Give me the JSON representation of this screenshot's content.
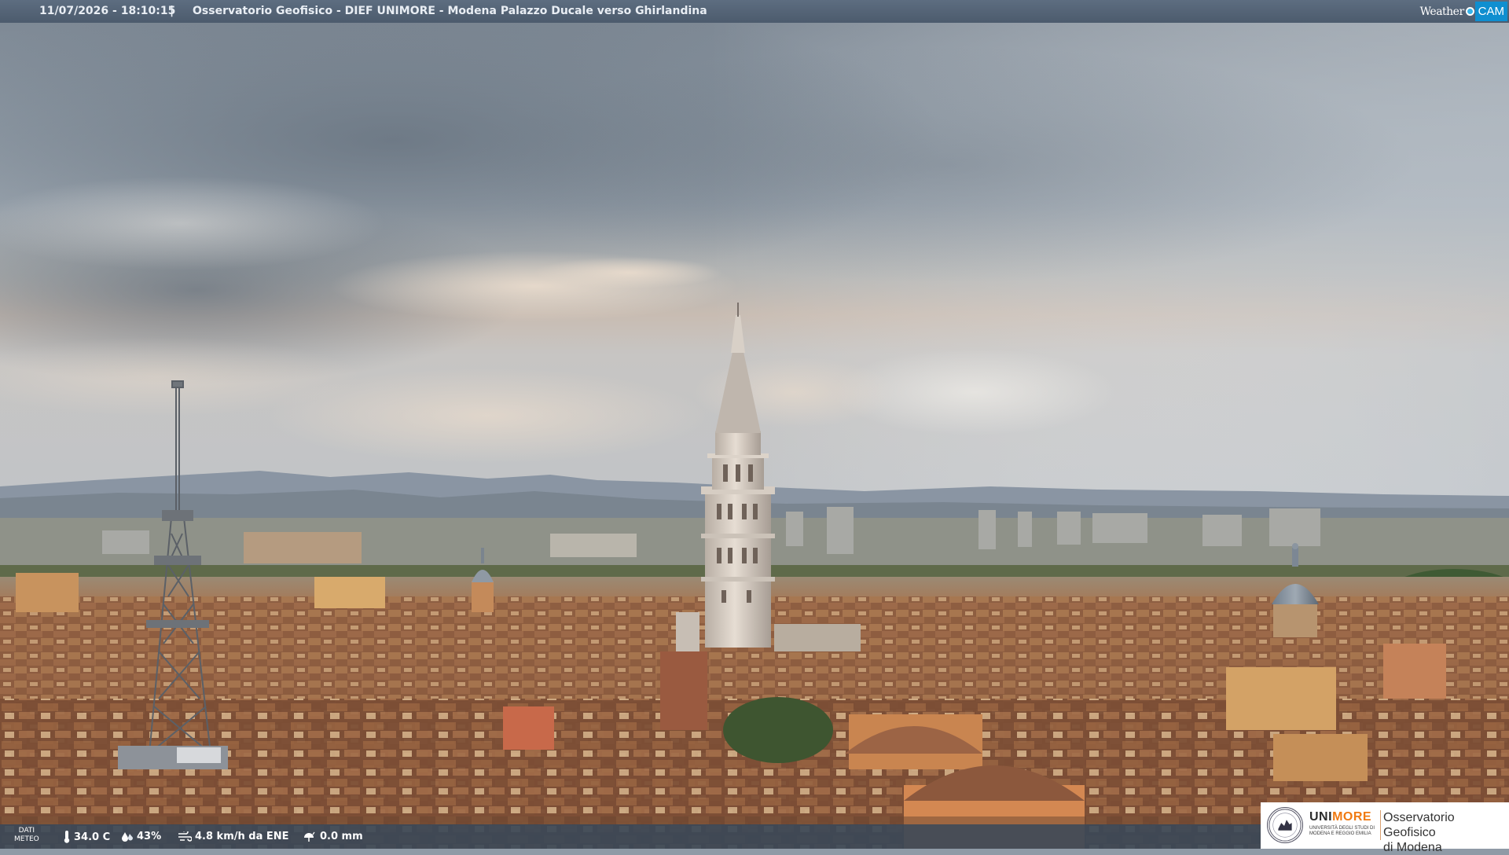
{
  "header": {
    "timestamp": "11/07/2026 - 18:10:15",
    "separator": "|",
    "title": "Osservatorio Geofisico - DIEF UNIMORE - Modena Palazzo Ducale verso Ghirlandina",
    "brand_weather": "Weather",
    "brand_cam": "CAM"
  },
  "meteo": {
    "label_line1": "DATI",
    "label_line2": "METEO",
    "temperature": "34.0 C",
    "humidity": "43%",
    "wind": "4.8 km/h da ENE",
    "rain": "0.0 mm"
  },
  "logo": {
    "uni_part1": "UNI",
    "uni_part2": "MORE",
    "sub_line1": "UNIVERSITÀ DEGLI STUDI DI",
    "sub_line2": "MODENA E REGGIO EMILIA",
    "obs_line1": "Osservatorio Geofisico",
    "obs_line2": "di Modena"
  },
  "colors": {
    "brand_blue": "#0f8fd0",
    "unimore_orange": "#f07a12",
    "bar_bg": "#4c5b6d"
  },
  "icons": {
    "temperature": "thermometer-icon",
    "humidity": "droplet-icon",
    "wind": "wind-icon",
    "rain": "rain-icon"
  }
}
